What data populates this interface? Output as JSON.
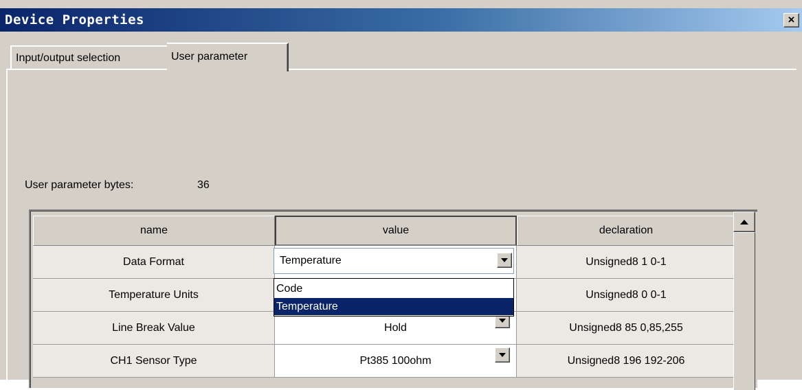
{
  "window": {
    "title": "Device Properties",
    "close_glyph": "×"
  },
  "tabs": [
    {
      "label": "Input/output selection",
      "active": false
    },
    {
      "label": "User parameter",
      "active": true
    }
  ],
  "user_parameter": {
    "bytes_label": "User parameter bytes:",
    "bytes_value": "36"
  },
  "grid": {
    "headers": {
      "name": "name",
      "value": "value",
      "declaration": "declaration"
    },
    "rows": [
      {
        "name": "Data Format",
        "value": "Temperature",
        "declaration": "Unsigned8  1 0-1"
      },
      {
        "name": "Temperature Units",
        "value": "Temperature",
        "declaration": "Unsigned8  0 0-1"
      },
      {
        "name": "Line Break Value",
        "value": "Hold",
        "declaration": "Unsigned8  85 0,85,255"
      },
      {
        "name": "CH1 Sensor Type",
        "value": "Pt385 100ohm",
        "declaration": "Unsigned8 196 192-206"
      }
    ]
  },
  "dropdown": {
    "options": [
      "Code",
      "Temperature"
    ],
    "selected": "Temperature"
  },
  "colors": {
    "titlebar_start": "#0a246a",
    "titlebar_end": "#a6caf0",
    "selection": "#0a246a",
    "face": "#d4d0c8"
  }
}
